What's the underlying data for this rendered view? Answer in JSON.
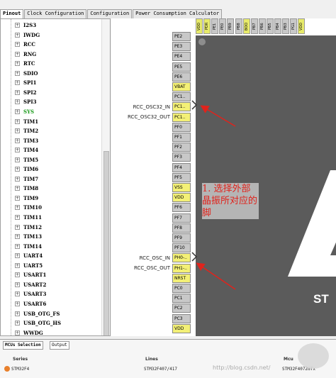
{
  "tabs": [
    "Pinout",
    "Clock Configuration",
    "Configuration",
    "Power Consumption Calculator"
  ],
  "tree_items": [
    {
      "label": "I2S3",
      "y": 0
    },
    {
      "label": "IWDG"
    },
    {
      "label": "RCC"
    },
    {
      "label": "RNG"
    },
    {
      "label": "RTC"
    },
    {
      "label": "SDIO"
    },
    {
      "label": "SPI1"
    },
    {
      "label": "SPI2"
    },
    {
      "label": "SPI3"
    },
    {
      "label": "SYS",
      "color": "green"
    },
    {
      "label": "TIM1"
    },
    {
      "label": "TIM2"
    },
    {
      "label": "TIM3"
    },
    {
      "label": "TIM4"
    },
    {
      "label": "TIM5"
    },
    {
      "label": "TIM6"
    },
    {
      "label": "TIM7"
    },
    {
      "label": "TIM8"
    },
    {
      "label": "TIM9"
    },
    {
      "label": "TIM10"
    },
    {
      "label": "TIM11"
    },
    {
      "label": "TIM12"
    },
    {
      "label": "TIM13"
    },
    {
      "label": "TIM14"
    },
    {
      "label": "UART4"
    },
    {
      "label": "UART5"
    },
    {
      "label": "USART1"
    },
    {
      "label": "USART2"
    },
    {
      "label": "USART3"
    },
    {
      "label": "USART6"
    },
    {
      "label": "USB_OTG_FS"
    },
    {
      "label": "USB_OTG_HS"
    },
    {
      "label": "WWDG"
    }
  ],
  "top_pins": [
    {
      "label": "VDD",
      "color": "yellow"
    },
    {
      "label": "PDR",
      "color": "yellow"
    },
    {
      "label": "PE1"
    },
    {
      "label": "PE0"
    },
    {
      "label": "PB9"
    },
    {
      "label": "PB8"
    },
    {
      "label": "BOO",
      "color": "yellow"
    },
    {
      "label": "PB7"
    },
    {
      "label": "PB6"
    },
    {
      "label": "PB5"
    },
    {
      "label": "PB4"
    },
    {
      "label": "PB3"
    },
    {
      "label": "PG1"
    },
    {
      "label": "VDD",
      "color": "yellow"
    }
  ],
  "side_pins": [
    {
      "label": "PE2"
    },
    {
      "label": "PE3"
    },
    {
      "label": "PE4"
    },
    {
      "label": "PE5"
    },
    {
      "label": "PE6"
    },
    {
      "label": "VBAT",
      "color": "yellow"
    },
    {
      "label": "PC1.."
    },
    {
      "label": "PC1..",
      "color": "yellow"
    },
    {
      "label": "PC1..",
      "color": "yellow"
    },
    {
      "label": "PF0"
    },
    {
      "label": "PF1"
    },
    {
      "label": "PF2"
    },
    {
      "label": "PF3"
    },
    {
      "label": "PF4"
    },
    {
      "label": "PF5"
    },
    {
      "label": "VSS",
      "color": "yellow"
    },
    {
      "label": "VDD",
      "color": "yellow"
    },
    {
      "label": "PF6"
    },
    {
      "label": "PF7"
    },
    {
      "label": "PF8"
    },
    {
      "label": "PF9"
    },
    {
      "label": "PF10"
    },
    {
      "label": "PH0-..",
      "color": "yellow"
    },
    {
      "label": "PH1-..",
      "color": "yellow"
    },
    {
      "label": "NRST",
      "color": "yellow"
    },
    {
      "label": "PC0"
    },
    {
      "label": "PC1"
    },
    {
      "label": "PC2"
    },
    {
      "label": "PC3"
    },
    {
      "label": "VDD",
      "color": "yellow"
    }
  ],
  "signals": {
    "osc32_in": "RCC_OSC32_IN",
    "osc32_out": "RCC_OSC32_OUT",
    "osc_in": "RCC_OSC_IN",
    "osc_out": "RCC_OSC_OUT"
  },
  "annotation": "1. 选择外部晶振所对应的脚",
  "chip_logo_text": "ST",
  "bottom": {
    "tabs": [
      "MCUs Selection",
      "Output"
    ],
    "headers": {
      "series": "Series",
      "lines": "Lines",
      "mcu": "Mcu"
    },
    "row": {
      "series": "STM32F4",
      "lines": "STM32F407/417",
      "mcu": "STM32F407ZGTx"
    }
  },
  "watermark": "http://blog.csdn.net/"
}
